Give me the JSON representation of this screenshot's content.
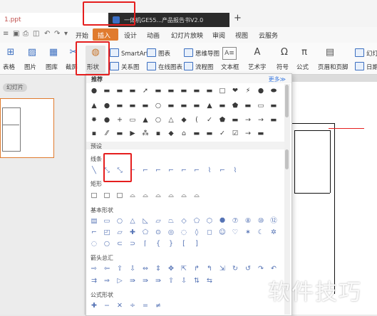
{
  "tabs": {
    "doc_tab": "1.ppt",
    "dark_tab": "一体机GE55...产品报告书V2.0",
    "add_tab": "+"
  },
  "ribbon_tabs": {
    "start": "开始",
    "insert": "插入",
    "design": "设计",
    "animation": "动画",
    "slideshow": "幻灯片放映",
    "review": "审阅",
    "view": "视图",
    "cloud": "云服务"
  },
  "toolbar": {
    "table": "表格",
    "picture": "图片",
    "gallery": "图库",
    "screenshot": "截屏",
    "shapes": "形状",
    "smartart": "SmartArt",
    "chart": "图表",
    "mindmap": "思维导图",
    "textbox_icon_label": "A≡",
    "relation": "关系图",
    "online_chart": "在线图表",
    "flowchart": "流程图",
    "textbox": "文本框",
    "wordart": "艺术字",
    "symbol": "符号",
    "formula": "公式",
    "header_footer": "页眉和页脚",
    "slide_num": "幻灯片",
    "datetime": "日期和"
  },
  "left_pane": {
    "slides_label": "幻灯片"
  },
  "shapes_panel": {
    "recommend": "推荐",
    "more": "更多≫",
    "preset": "预设",
    "lines": "线条",
    "rect": "矩形",
    "basic": "基本形状",
    "arrows": "箭头总汇",
    "formula_shapes": "公式形状",
    "row_rec1": [
      "●",
      "▬",
      "▬",
      "▬",
      "➚",
      "▬",
      "▬",
      "▬",
      "▬",
      "▬",
      "□",
      "❤",
      "⚡",
      "●",
      "⬬"
    ],
    "row_rec2": [
      "▲",
      "●",
      "▬",
      "▬",
      "▬",
      "○",
      "▬",
      "▬",
      "▬",
      "▲",
      "▬",
      "⬟",
      "▬",
      "▭",
      "▬"
    ],
    "row_rec3": [
      "✸",
      "●",
      "+",
      "▭",
      "▲",
      "○",
      "△",
      "◆",
      "(",
      "✓",
      "⬟",
      "▬",
      "→",
      "→",
      "▬"
    ],
    "row_rec4": [
      "▪",
      "⁄⁄",
      "▬",
      "▶",
      "⁂",
      "▪",
      "◆",
      "⌂",
      "▬",
      "▬",
      "✓",
      "☑",
      "→",
      "▬"
    ],
    "row_lines": [
      "╲",
      "⤡",
      "⤡",
      "⌐",
      "⌐",
      "⌐",
      "⌐",
      "⌐",
      "⌐",
      "⌇",
      "⌐",
      "⌇"
    ],
    "row_rect": [
      "□",
      "□",
      "□",
      "⌓",
      "⌓",
      "⌓",
      "⌓",
      "⌓",
      "⌓"
    ],
    "row_basic1": [
      "▤",
      "▭",
      "○",
      "△",
      "◺",
      "▱",
      "⏢",
      "◇",
      "⬠",
      "⬡",
      "⯃",
      "⑦",
      "⑧",
      "⑩",
      "⑫"
    ],
    "row_basic2": [
      "⌐",
      "◰",
      "▱",
      "✚",
      "⬠",
      "⊙",
      "◎",
      "◌",
      "◊",
      "◻",
      "☺",
      "♡",
      "✶",
      "☾",
      "✲"
    ],
    "row_basic3": [
      "◌",
      "○",
      "⊂",
      "⊃",
      "⌈",
      "{",
      "}",
      "[",
      "]"
    ],
    "row_arrows1": [
      "⇨",
      "⇦",
      "⇧",
      "⇩",
      "⇔",
      "⇕",
      "✥",
      "⇱",
      "↱",
      "↰",
      "⇲",
      "↻",
      "↺",
      "↷",
      "↶"
    ],
    "row_arrows2": [
      "⇉",
      "⇒",
      "▷",
      "⇛",
      "⇛",
      "⇛",
      "⇧",
      "⇩",
      "⇅",
      "⇆"
    ],
    "row_formula": [
      "✚",
      "−",
      "✕",
      "÷",
      "=",
      "≠"
    ]
  },
  "watermark": "软件技巧"
}
